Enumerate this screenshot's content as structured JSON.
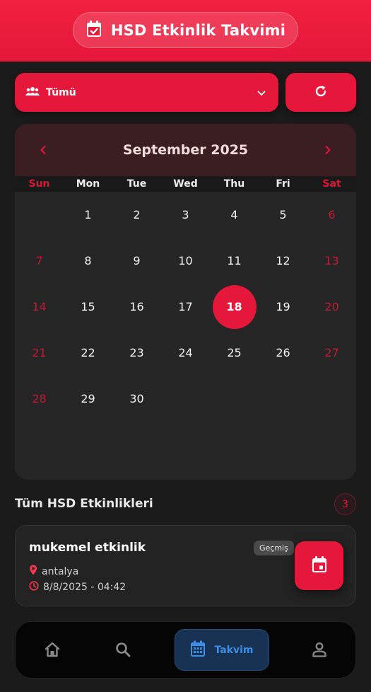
{
  "header": {
    "title": "HSD Etkinlik Takvimi"
  },
  "filter": {
    "selected": "Tümü"
  },
  "calendar": {
    "month_label": "September 2025",
    "weekdays": [
      "Sun",
      "Mon",
      "Tue",
      "Wed",
      "Thu",
      "Fri",
      "Sat"
    ],
    "leading_blanks": 1,
    "days": [
      "1",
      "2",
      "3",
      "4",
      "5",
      "6",
      "7",
      "8",
      "9",
      "10",
      "11",
      "12",
      "13",
      "14",
      "15",
      "16",
      "17",
      "18",
      "19",
      "20",
      "21",
      "22",
      "23",
      "24",
      "25",
      "26",
      "27",
      "28",
      "29",
      "30"
    ],
    "today": "18"
  },
  "events_section": {
    "title": "Tüm HSD Etkinlikleri",
    "count": "3"
  },
  "events": [
    {
      "title": "mukemel etkinlik",
      "location": "antalya",
      "datetime": "8/8/2025 - 04:42",
      "status": "Geçmiş"
    }
  ],
  "bottom_nav": {
    "active_label": "Takvim"
  },
  "colors": {
    "accent": "#e5173a",
    "active_nav": "#3d8fe6"
  }
}
